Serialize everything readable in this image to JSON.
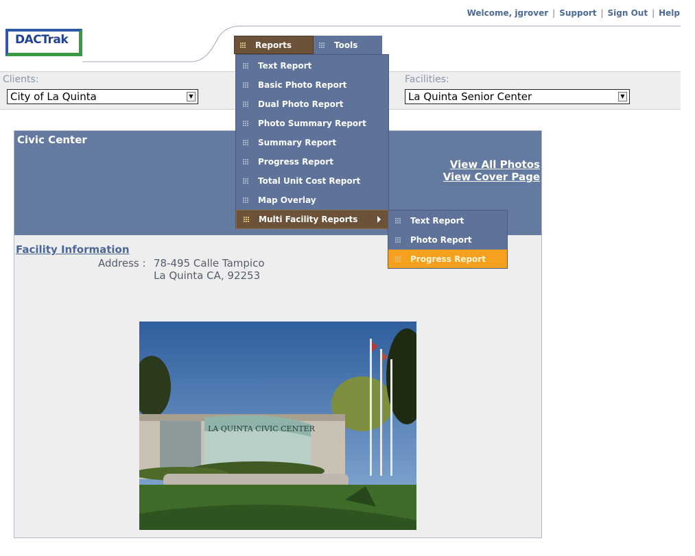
{
  "header": {
    "welcome": "Welcome, jgrover",
    "links": [
      "Support",
      "Sign Out",
      "Help"
    ],
    "logo": "DACTrak"
  },
  "menu": {
    "reports_label": "Reports",
    "tools_label": "Tools",
    "reports_items": [
      "Text Report",
      "Basic Photo Report",
      "Dual Photo Report",
      "Photo Summary Report",
      "Summary Report",
      "Progress Report",
      "Total Unit Cost Report",
      "Map Overlay",
      "Multi Facility Reports"
    ],
    "multi_facility_items": [
      "Text Report",
      "Photo Report",
      "Progress Report"
    ],
    "highlighted_submenu_item": "Progress Report"
  },
  "filters": {
    "clients_label": "Clients:",
    "clients_value": "City of La Quinta",
    "facilities_label": "Facilities:",
    "facilities_value": "La Quinta Senior Center"
  },
  "panel": {
    "title": "Civic Center",
    "view_all_photos": "View All Photos",
    "view_cover_page": "View Cover Page",
    "facility_info_label": "Facility Information",
    "address_label": "Address :",
    "address_line1": "78-495 Calle Tampico",
    "address_line2": "La Quinta CA, 92253",
    "photo_sign_text": "LA QUINTA  CIVIC  CENTER"
  },
  "colors": {
    "menu_blue": "#5e729a",
    "menu_brown": "#6b5238",
    "highlight_orange": "#f5a01e",
    "panel_header": "#647aa1"
  }
}
